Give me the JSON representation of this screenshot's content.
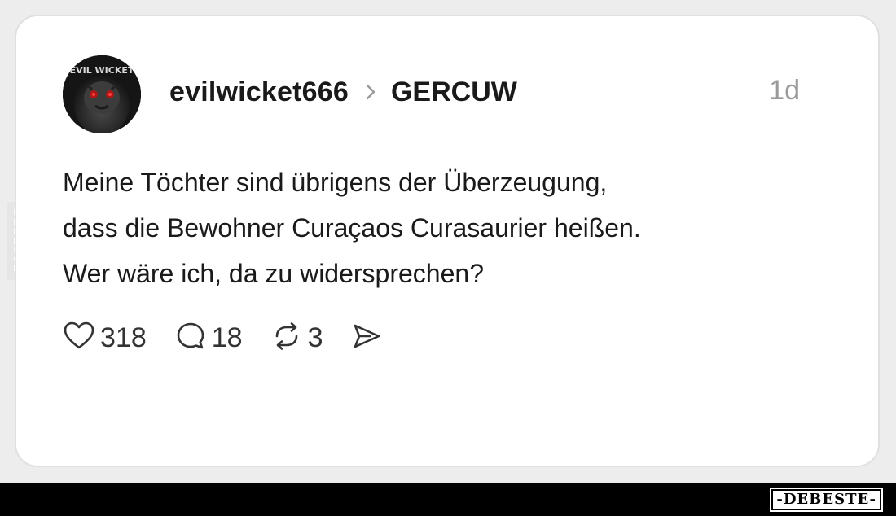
{
  "post": {
    "author": "evilwicket666",
    "avatar_text": "EVIL WICKET",
    "community": "GERCUW",
    "time": "1d",
    "lines": [
      "Meine Töchter sind übrigens der Überzeugung,",
      "dass die Bewohner Curaçaos Curasaurier heißen.",
      "Wer wäre ich, da zu widersprechen?"
    ],
    "actions": {
      "likes": "318",
      "comments": "18",
      "reposts": "3"
    },
    "icons": {
      "like": "heart-icon",
      "comment": "comment-bubble-icon",
      "repost": "repost-icon",
      "share": "send-icon",
      "chevron": "chevron-right-icon"
    }
  },
  "watermark": {
    "side": "DEBESTE",
    "footer": "-DEBESTE-"
  },
  "colors": {
    "text": "#1a1a1a",
    "muted": "#9a9a9a",
    "card": "#ffffff",
    "background": "#ededed",
    "footer": "#000000"
  }
}
